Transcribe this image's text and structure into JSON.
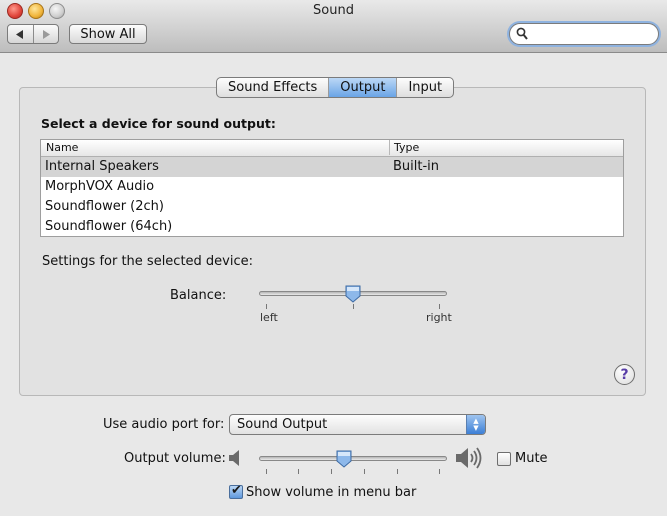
{
  "window": {
    "title": "Sound"
  },
  "toolbar": {
    "back_icon": "left-arrow-icon",
    "forward_icon": "right-arrow-icon",
    "show_all_label": "Show All",
    "search_value": ""
  },
  "tabs": [
    {
      "label": "Sound Effects",
      "active": false
    },
    {
      "label": "Output",
      "active": true
    },
    {
      "label": "Input",
      "active": false
    }
  ],
  "output": {
    "heading": "Select a device for sound output:",
    "columns": [
      "Name",
      "Type"
    ],
    "devices": [
      {
        "name": "Internal Speakers",
        "type": "Built-in",
        "selected": true
      },
      {
        "name": "MorphVOX Audio",
        "type": "",
        "selected": false
      },
      {
        "name": "Soundflower (2ch)",
        "type": "",
        "selected": false
      },
      {
        "name": "Soundflower (64ch)",
        "type": "",
        "selected": false
      }
    ],
    "settings_label": "Settings for the selected device:",
    "balance": {
      "label": "Balance:",
      "left_label": "left",
      "right_label": "right",
      "value": 0.5
    }
  },
  "bottom": {
    "audio_port_label": "Use audio port for:",
    "audio_port_value": "Sound Output",
    "output_volume_label": "Output volume:",
    "output_volume_value": 0.45,
    "mute_label": "Mute",
    "mute_checked": false,
    "show_volume_label": "Show volume in menu bar",
    "show_volume_checked": true
  },
  "colors": {
    "selection": "#d4d4d4",
    "accent": "#5e98dc"
  }
}
